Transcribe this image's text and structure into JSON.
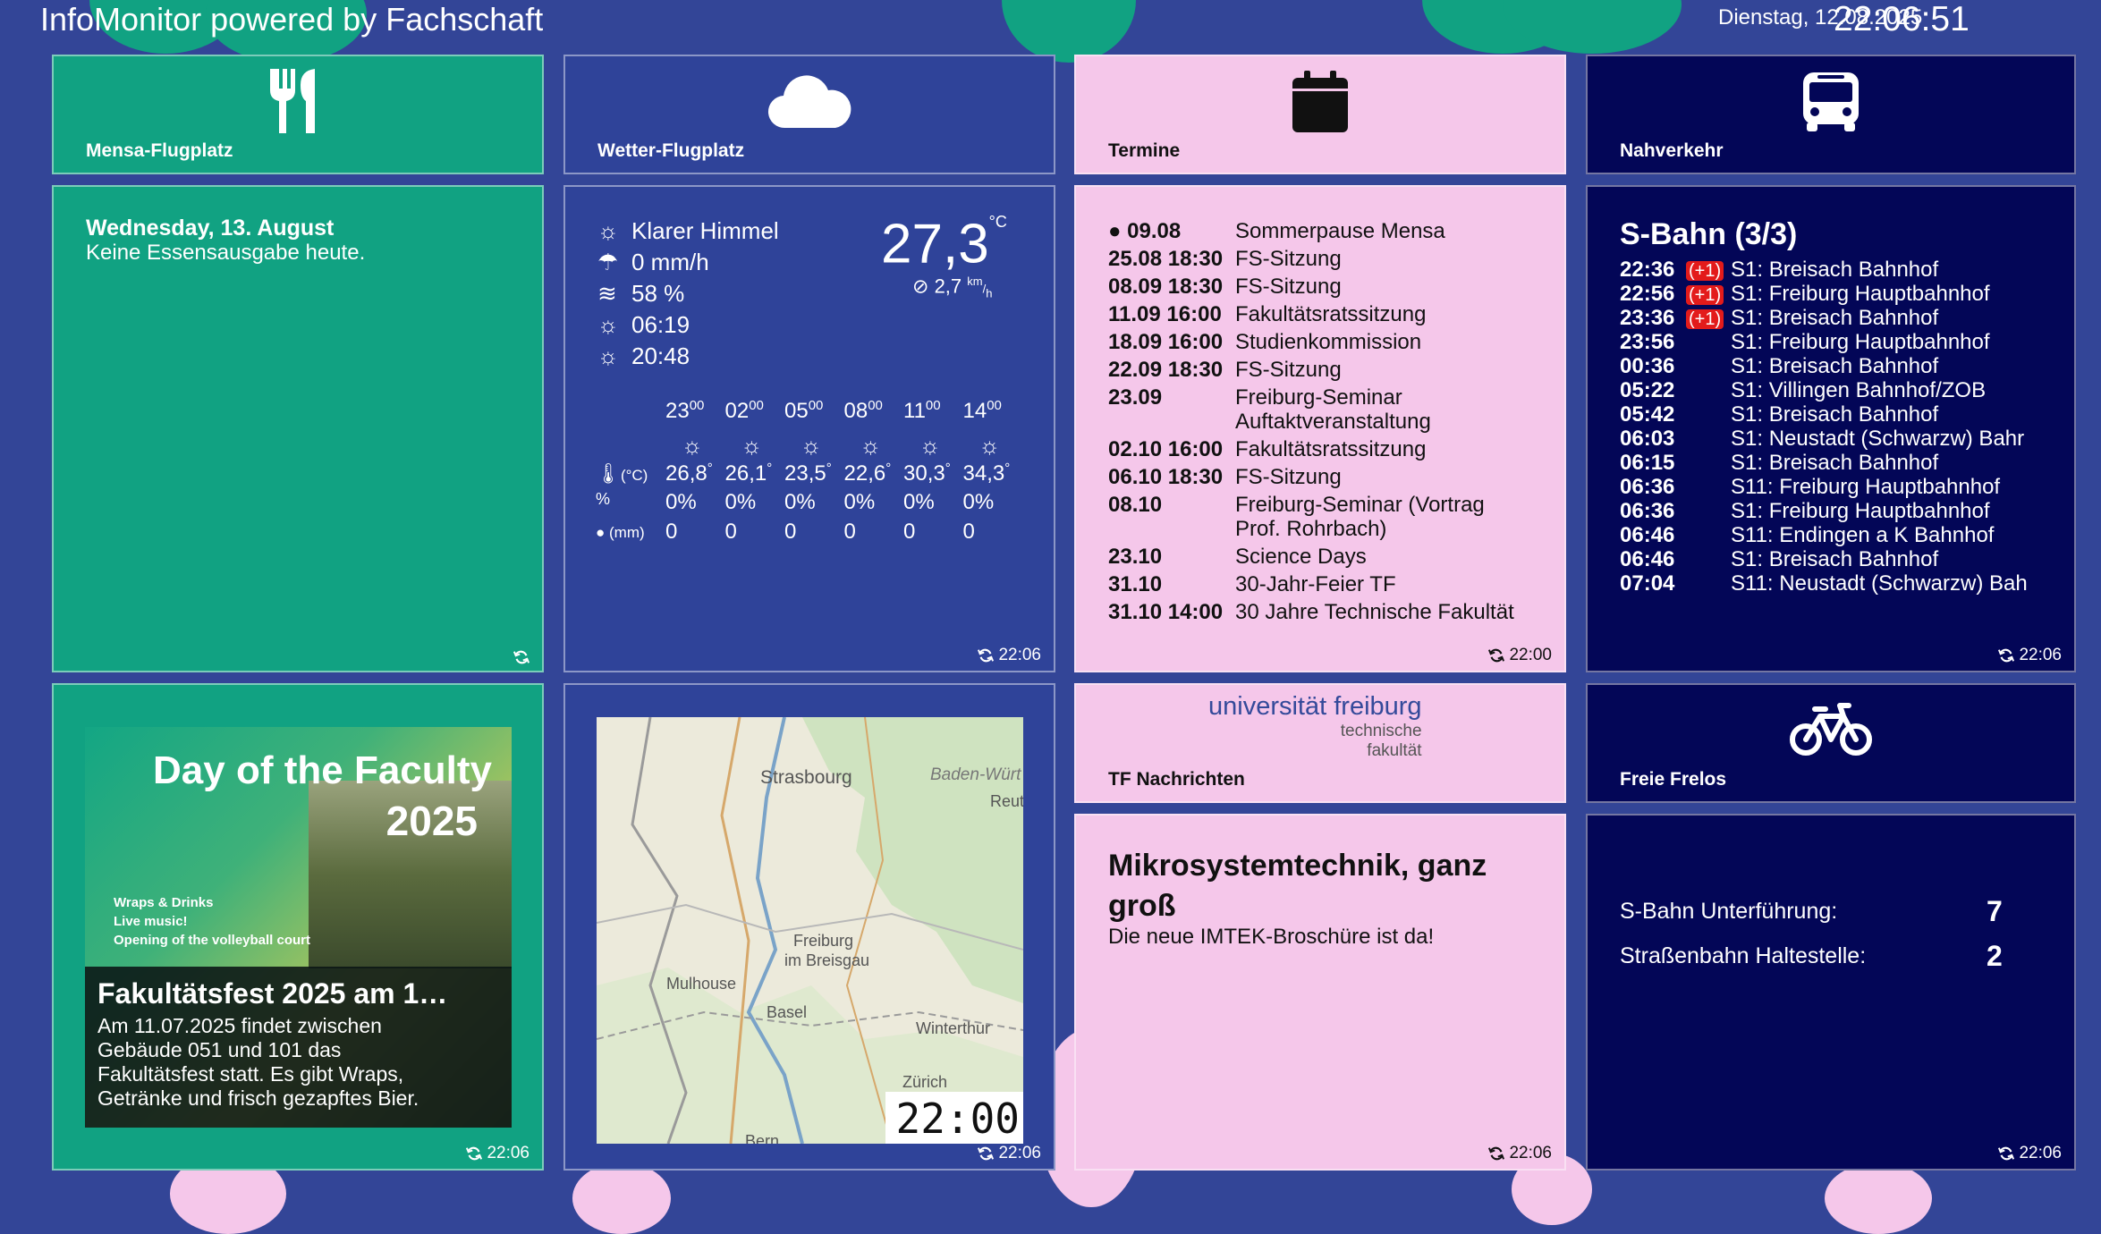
{
  "header": {
    "title": "InfoMonitor powered by Fachschaft",
    "date": "Dienstag, 12.08.2025",
    "time": "22:06:51"
  },
  "colors": {
    "background": "#334597",
    "mensa_green": "#11a282",
    "weather_blue": "#2f4399",
    "events_pink": "#f5c7ea",
    "transit_navy": "#030657",
    "delay_red": "#e31b1b"
  },
  "mensa": {
    "title": "Mensa-Flugplatz",
    "icon": "fork-knife-icon",
    "date": "Wednesday, 13. August",
    "message": "Keine Essensausgabe heute."
  },
  "weather": {
    "title": "Wetter-Flugplatz",
    "icon": "cloud-icon",
    "condition": "Klarer Himmel",
    "precip": "0 mm/h",
    "humidity": "58 %",
    "sunrise": "06:19",
    "sunset": "20:48",
    "temp": "27,3",
    "temp_unit": "°C",
    "wind": "2,7",
    "wind_unit_top": "km",
    "wind_unit_bottom": "h",
    "row_label_temp": "(°C)",
    "row_label_rain": "(mm)",
    "refresh_time": "22:06",
    "forecast": [
      {
        "hour": "23",
        "min": "00",
        "temp": "26,8",
        "deg": "°",
        "prob": "0%",
        "mm": "0"
      },
      {
        "hour": "02",
        "min": "00",
        "temp": "26,1",
        "deg": "°",
        "prob": "0%",
        "mm": "0"
      },
      {
        "hour": "05",
        "min": "00",
        "temp": "23,5",
        "deg": "°",
        "prob": "0%",
        "mm": "0"
      },
      {
        "hour": "08",
        "min": "00",
        "temp": "22,6",
        "deg": "°",
        "prob": "0%",
        "mm": "0"
      },
      {
        "hour": "11",
        "min": "00",
        "temp": "30,3",
        "deg": "°",
        "prob": "0%",
        "mm": "0"
      },
      {
        "hour": "14",
        "min": "00",
        "temp": "34,3",
        "deg": "°",
        "prob": "0%",
        "mm": "0"
      }
    ]
  },
  "events": {
    "title": "Termine",
    "icon": "calendar-icon",
    "refresh_time": "22:00",
    "items": [
      {
        "date": "09.08",
        "text": "Sommerpause Mensa"
      },
      {
        "date": "25.08 18:30",
        "text": "FS-Sitzung"
      },
      {
        "date": "08.09 18:30",
        "text": "FS-Sitzung"
      },
      {
        "date": "11.09 16:00",
        "text": "Fakultätsratssitzung"
      },
      {
        "date": "18.09 16:00",
        "text": "Studienkommission"
      },
      {
        "date": "22.09 18:30",
        "text": "FS-Sitzung"
      },
      {
        "date": "23.09",
        "text": "Freiburg-Seminar Auftaktveranstaltung"
      },
      {
        "date": "02.10 16:00",
        "text": "Fakultätsratssitzung"
      },
      {
        "date": "06.10 18:30",
        "text": "FS-Sitzung"
      },
      {
        "date": "08.10",
        "text": "Freiburg-Seminar (Vortrag Prof. Rohrbach)"
      },
      {
        "date": "23.10",
        "text": "Science Days"
      },
      {
        "date": "31.10",
        "text": "30-Jahr-Feier TF"
      },
      {
        "date": "31.10 14:00",
        "text": "30 Jahre Technische Fakultät"
      }
    ]
  },
  "transit": {
    "title": "Nahverkehr",
    "icon": "bus-icon",
    "heading": "S-Bahn (3/3)",
    "refresh_time": "22:06",
    "departures": [
      {
        "time": "22:36",
        "delay": "(+1)",
        "dest": "S1: Breisach Bahnhof"
      },
      {
        "time": "22:56",
        "delay": "(+1)",
        "dest": "S1: Freiburg Hauptbahnhof"
      },
      {
        "time": "23:36",
        "delay": "(+1)",
        "dest": "S1: Breisach Bahnhof"
      },
      {
        "time": "23:56",
        "delay": "",
        "dest": "S1: Freiburg Hauptbahnhof"
      },
      {
        "time": "00:36",
        "delay": "",
        "dest": "S1: Breisach Bahnhof"
      },
      {
        "time": "05:22",
        "delay": "",
        "dest": "S1: Villingen Bahnhof/ZOB"
      },
      {
        "time": "05:42",
        "delay": "",
        "dest": "S1: Breisach Bahnhof"
      },
      {
        "time": "06:03",
        "delay": "",
        "dest": "S1: Neustadt (Schwarzw) Bahr"
      },
      {
        "time": "06:15",
        "delay": "",
        "dest": "S1: Breisach Bahnhof"
      },
      {
        "time": "06:36",
        "delay": "",
        "dest": "S11: Freiburg Hauptbahnhof"
      },
      {
        "time": "06:36",
        "delay": "",
        "dest": "S1: Freiburg Hauptbahnhof"
      },
      {
        "time": "06:46",
        "delay": "",
        "dest": "S11: Endingen a K Bahnhof"
      },
      {
        "time": "06:46",
        "delay": "",
        "dest": "S1: Breisach Bahnhof"
      },
      {
        "time": "07:04",
        "delay": "",
        "dest": "S11: Neustadt (Schwarzw) Bah"
      }
    ]
  },
  "news": {
    "poster_title_line1": "Day of the Faculty",
    "poster_title_line2": "2025",
    "poster_line1": "Wraps & Drinks",
    "poster_line2": "Live music!",
    "poster_line3": "Opening of the volleyball court",
    "headline": "Fakultätsfest 2025 am 1…",
    "body": "Am 11.07.2025 findet zwischen Gebäude 051 und 101 das Fakultätsfest statt. Es gibt Wraps, Getränke und frisch gezapftes Bier.",
    "refresh_time": "22:06"
  },
  "map": {
    "labels": [
      "Strasbourg",
      "Baden-Würt",
      "Reut",
      "Freiburg",
      "im Breisgau",
      "Mulhouse",
      "Basel",
      "Winterthur",
      "Zürich",
      "Bern"
    ],
    "clock": "22:00",
    "refresh_time": "22:06"
  },
  "tf_news": {
    "logo_main": "universität freiburg",
    "logo_sub1": "technische",
    "logo_sub2": "fakultät",
    "title": "TF Nachrichten",
    "headline": "Mikrosystemtechnik, ganz groß",
    "subline": "Die neue IMTEK-Broschüre ist da!",
    "refresh_time": "22:06"
  },
  "bikes": {
    "title": "Freie Frelos",
    "icon": "bicycle-icon",
    "refresh_time": "22:06",
    "stations": [
      {
        "name": "S-Bahn Unterführung:",
        "count": "7"
      },
      {
        "name": "Straßenbahn Haltestelle:",
        "count": "2"
      }
    ]
  }
}
